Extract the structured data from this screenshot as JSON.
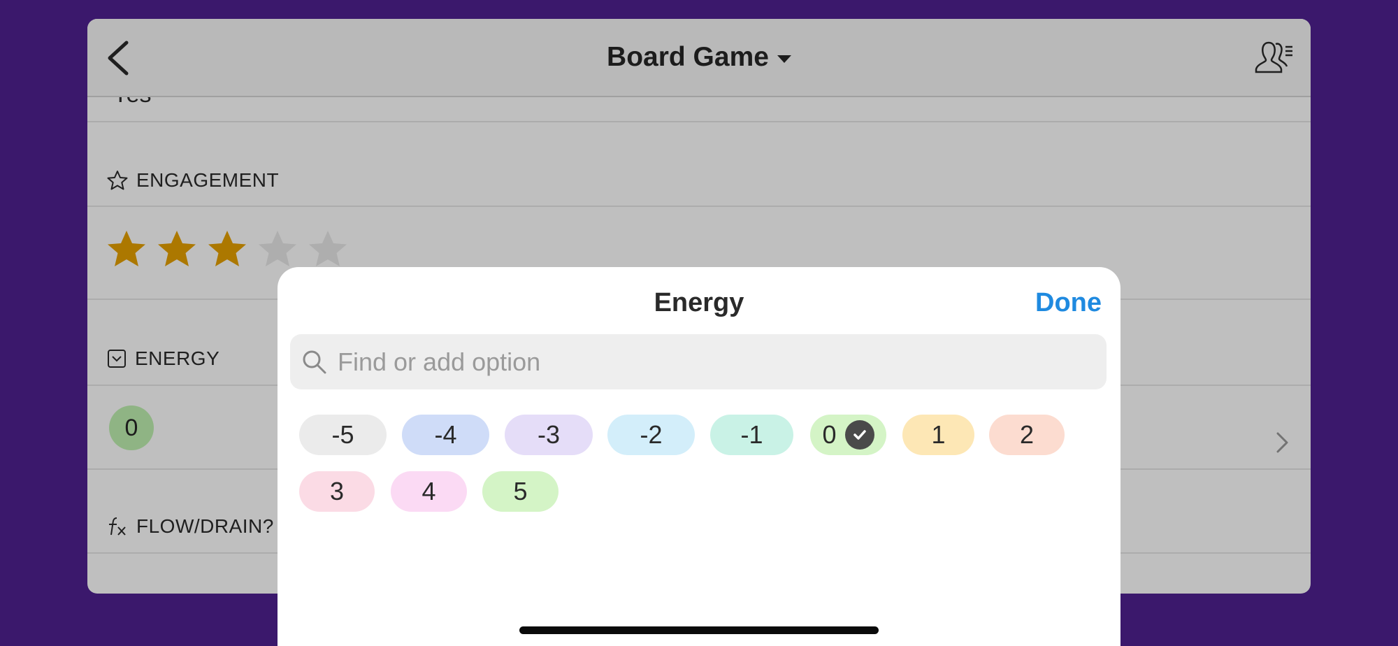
{
  "header": {
    "title": "Board Game",
    "back_icon": "chevron-left-icon",
    "people_icon": "people-list-icon"
  },
  "fields": {
    "cut_value": "Yes",
    "engagement": {
      "label": "ENGAGEMENT",
      "icon": "star-outline-icon",
      "rating": 3,
      "max": 5,
      "filled_color": "#e6a000",
      "empty_color": "#e8e8e8"
    },
    "energy": {
      "label": "ENERGY",
      "icon": "dropdown-select-icon",
      "value": "0",
      "value_color": "#bff0b0"
    },
    "flow": {
      "label": "FLOW/DRAIN?",
      "icon": "formula-fx-icon"
    }
  },
  "sheet": {
    "title": "Energy",
    "done_label": "Done",
    "search_placeholder": "Find or add option",
    "selected": "0",
    "options": [
      {
        "label": "-5",
        "color": "#ebebeb"
      },
      {
        "label": "-4",
        "color": "#cfdcf8"
      },
      {
        "label": "-3",
        "color": "#e5ddf8"
      },
      {
        "label": "-2",
        "color": "#d3eefa"
      },
      {
        "label": "-1",
        "color": "#c9f2e6"
      },
      {
        "label": "0",
        "color": "#d4f4c6"
      },
      {
        "label": "1",
        "color": "#fde7b5"
      },
      {
        "label": "2",
        "color": "#fcdcd0"
      },
      {
        "label": "3",
        "color": "#fbdbe5"
      },
      {
        "label": "4",
        "color": "#fbdaf4"
      },
      {
        "label": "5",
        "color": "#d4f4c6"
      }
    ]
  }
}
